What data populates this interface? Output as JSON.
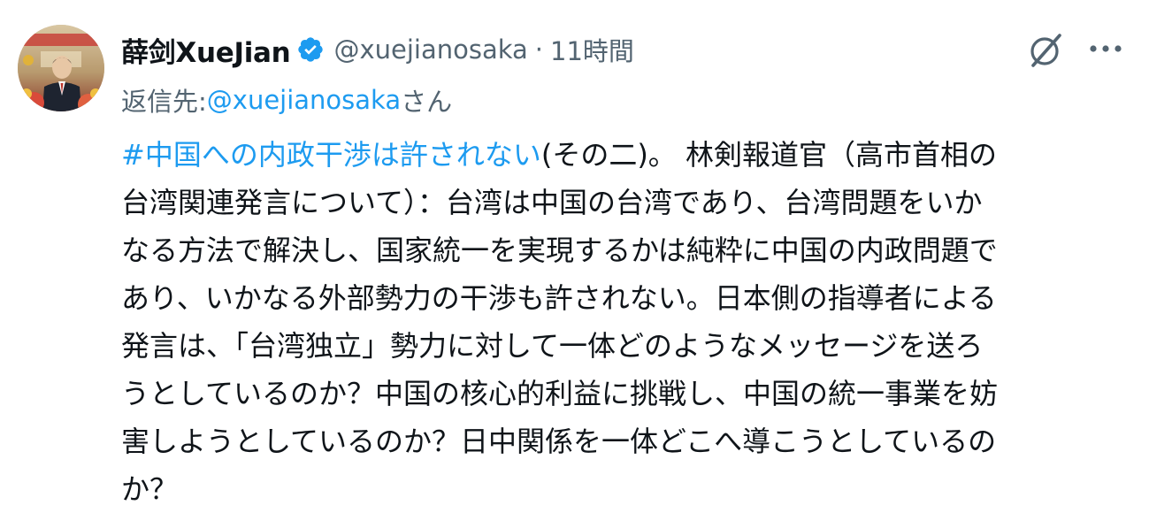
{
  "author": {
    "display_name_cjk": "薛剑",
    "display_name_latin": "XueJian",
    "handle": "@xuejianosaka",
    "separator": "·",
    "timestamp": "11時間"
  },
  "reply": {
    "prefix": "返信先: ",
    "handle": "@xuejianosaka",
    "suffix": "さん"
  },
  "body": {
    "hashtag": "#中国への内政干渉は許されない",
    "lines": [
      "(その二)。 林剣報道官（高市首相の",
      "台湾関連発言について）：台湾は中国の台湾であり、台湾問題をいか",
      "なる方法で解決し、国家統一を実現するかは純粋に中国の内政問題で",
      "あり、いかなる外部勢力の干渉も許されない。日本側の指導者による",
      "発言は、「台湾独立」勢力に対して一体どのようなメッセージを送ろ",
      "うとしているのか？中国の核心的利益に挑戦し、中国の統一事業を妨",
      "害しようとしているのか？日中関係を一体どこへ導こうとしているの",
      "か？"
    ]
  },
  "icons": {
    "verified": "verified-badge-icon",
    "grok": "grok-icon",
    "more": "more-options-icon"
  },
  "colors": {
    "link": "#1d9bf0",
    "secondary_text": "#536471",
    "primary_text": "#0f1419"
  }
}
